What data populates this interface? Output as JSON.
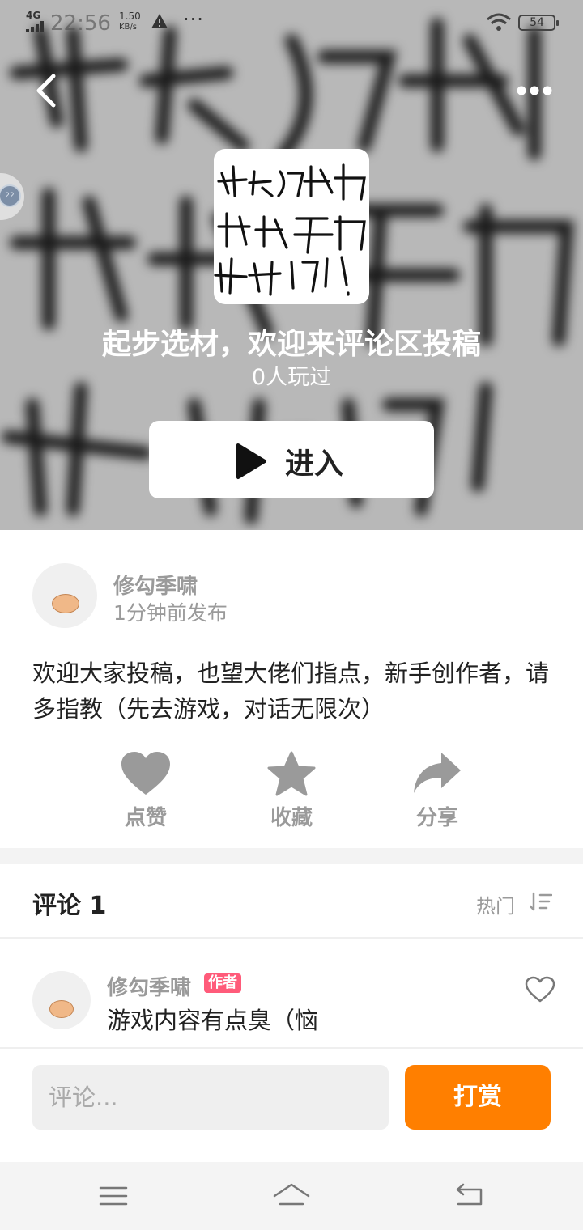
{
  "status_bar": {
    "network": "4G",
    "time": "22:56",
    "speed_value": "1.50",
    "speed_unit": "KB/s",
    "more": "···",
    "battery": "54"
  },
  "float_ball": {
    "label": "22"
  },
  "game": {
    "cover_lines": [
      "先去游戏中",
      "试玩,再",
      "来评论区!"
    ],
    "title": "起步选材，欢迎来评论区投稿",
    "played": "0人玩过",
    "enter_label": "进入"
  },
  "post": {
    "author": "修勾季啸",
    "time": "1分钟前发布",
    "description": "欢迎大家投稿，也望大佬们指点，新手创作者，请多指教（先去游戏，对话无限次）"
  },
  "actions": [
    {
      "label": "点赞",
      "icon": "heart-icon"
    },
    {
      "label": "收藏",
      "icon": "star-icon"
    },
    {
      "label": "分享",
      "icon": "share-icon"
    }
  ],
  "comments": {
    "title": "评论 1",
    "sort_label": "热门",
    "items": [
      {
        "author": "修勾季啸",
        "badge": "作者",
        "text": "游戏内容有点臭（恼"
      }
    ]
  },
  "bottom_bar": {
    "placeholder": "评论...",
    "tip_label": "打赏"
  },
  "colors": {
    "accent": "#ff7f00",
    "badge": "#ff5b7a",
    "muted_text": "#9a9a9a"
  }
}
